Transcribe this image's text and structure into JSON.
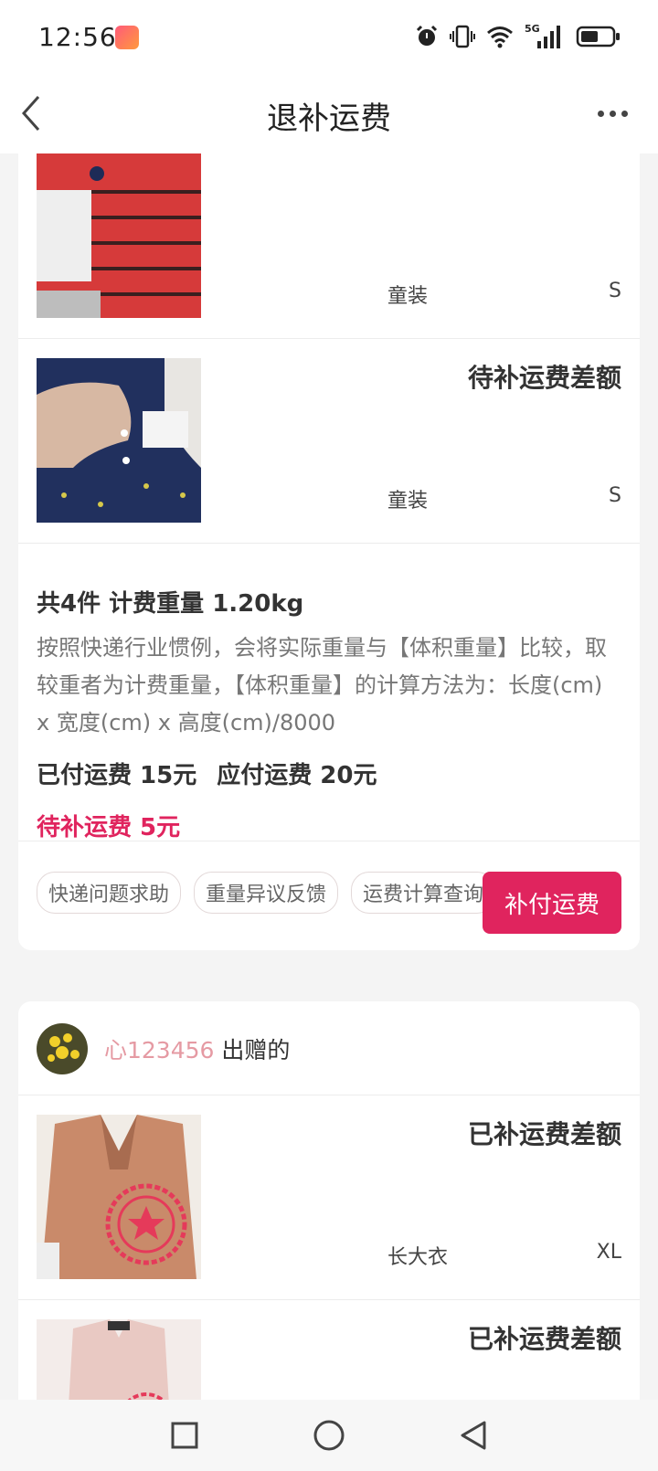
{
  "status_bar": {
    "time": "12:56",
    "network": "5G"
  },
  "header": {
    "title": "退补运费"
  },
  "card1": {
    "items": [
      {
        "status": "",
        "category": "童装",
        "size": "S"
      },
      {
        "status": "待补运费差额",
        "category": "童装",
        "size": "S"
      }
    ],
    "summary": {
      "title": "共4件 计费重量 1.20kg",
      "description": "按照快递行业惯例，会将实际重量与【体积重量】比较，取较重者为计费重量，【体积重量】的计算方法为：长度(cm) x 宽度(cm) x 高度(cm)/8000",
      "paid": "已付运费 15元",
      "payable": "应付运费 20元",
      "due": "待补运费 5元"
    },
    "tags": [
      "快递问题求助",
      "重量异议反馈",
      "运费计算查询"
    ],
    "pay_button": "补付运费"
  },
  "card2": {
    "giver_name": "心123456",
    "giver_suffix": " 出赠的",
    "items": [
      {
        "status": "已补运费差额",
        "category": "长大衣",
        "size": "XL"
      },
      {
        "status": "已补运费差额",
        "category": "",
        "size": ""
      }
    ]
  },
  "colors": {
    "accent": "#e0245e",
    "giver_name": "#e59aa3",
    "background": "#f4f4f4"
  }
}
